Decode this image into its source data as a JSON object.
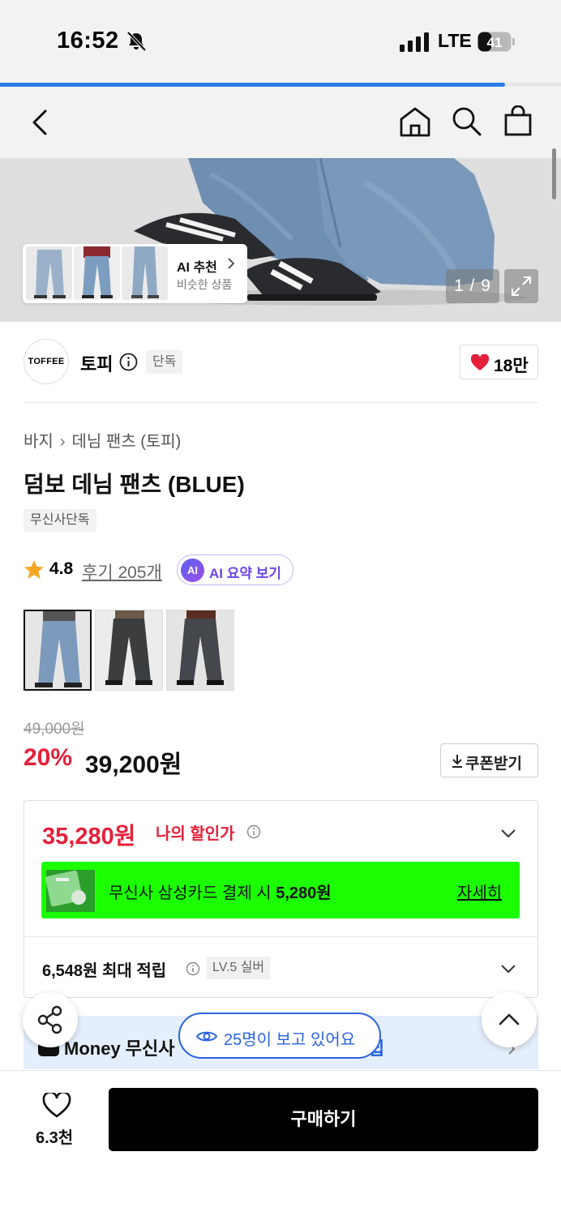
{
  "status_bar": {
    "time": "16:52",
    "network": "LTE",
    "battery": "41"
  },
  "page_progress": 0.9,
  "gallery": {
    "counter": "1 / 9",
    "ai_recommend": {
      "title": "AI 추천",
      "subtitle": "비슷한 상품"
    }
  },
  "brand": {
    "logo_text": "TOFFEE",
    "name": "토피",
    "tag": "단독",
    "likes": "18만"
  },
  "product": {
    "breadcrumb": [
      "바지",
      "데님 팬츠 (토피)"
    ],
    "title": "덤보 데님 팬츠 (BLUE)",
    "exclusive_tag": "무신사단독",
    "rating": "4.8",
    "reviews": "후기 205개",
    "ai_summary": {
      "badge": "AI",
      "label": "AI 요약 보기"
    }
  },
  "price": {
    "original": "49,000원",
    "discount": "20%",
    "sale": "39,200원",
    "coupon_label": "쿠폰받기",
    "my_price": "35,280원",
    "my_price_label": "나의 할인가",
    "card_offer_prefix": "무신사 삼성카드 결제 시 ",
    "card_offer_amount": "5,280원",
    "card_detail": "자세히",
    "points": "6,548원 최대 적립",
    "level": "LV.5 실버"
  },
  "money_banner": {
    "text": "Money  무신사",
    "right": "립"
  },
  "viewers": "25명이 보고 있어요",
  "bottom": {
    "wish_count": "6.3천",
    "buy_label": "구매하기"
  },
  "colors": {
    "accent_red": "#e6203b",
    "accent_blue": "#2b63e0",
    "card_green": "#1bff02",
    "ai_purple": "#6a45e8"
  }
}
